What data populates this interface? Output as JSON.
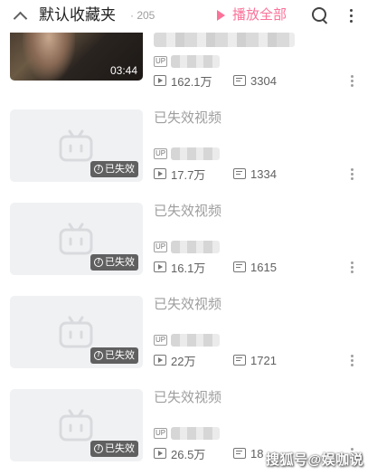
{
  "header": {
    "title": "默认收藏夹",
    "count": "· 205",
    "play_all": "播放全部",
    "accent": "#fb7299"
  },
  "items": [
    {
      "title": "",
      "duration": "03:44",
      "up_tag": "UP",
      "views": "162.1万",
      "danmaku": "3304",
      "invalid": false
    },
    {
      "title": "已失效视频",
      "badge": "已失效",
      "up_tag": "UP",
      "views": "17.7万",
      "danmaku": "1334",
      "invalid": true
    },
    {
      "title": "已失效视频",
      "badge": "已失效",
      "up_tag": "UP",
      "views": "16.1万",
      "danmaku": "1615",
      "invalid": true
    },
    {
      "title": "已失效视频",
      "badge": "已失效",
      "up_tag": "UP",
      "views": "22万",
      "danmaku": "1721",
      "invalid": true
    },
    {
      "title": "已失效视频",
      "badge": "已失效",
      "up_tag": "UP",
      "views": "26.5万",
      "danmaku": "18",
      "invalid": true
    }
  ],
  "watermark": "搜狐号@娱咖说"
}
